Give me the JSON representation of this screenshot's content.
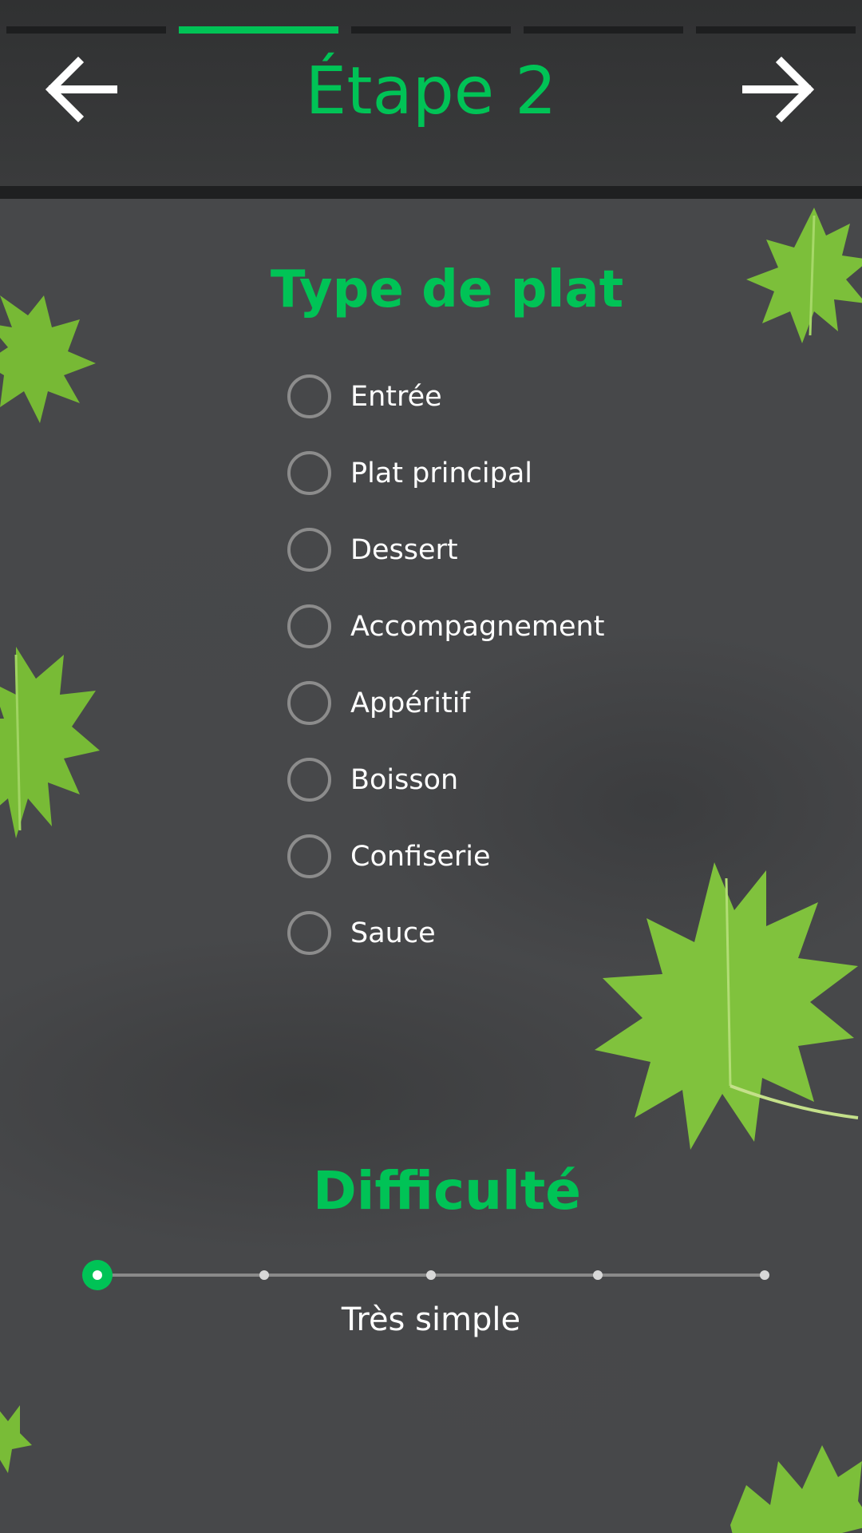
{
  "header": {
    "title": "Étape 2",
    "back_icon": "arrow-left-icon",
    "next_icon": "arrow-right-icon",
    "steps": [
      {
        "active": false
      },
      {
        "active": true
      },
      {
        "active": false
      },
      {
        "active": false
      },
      {
        "active": false
      }
    ]
  },
  "dish_type": {
    "title": "Type de plat",
    "options": [
      {
        "label": "Entrée",
        "selected": false
      },
      {
        "label": "Plat principal",
        "selected": false
      },
      {
        "label": "Dessert",
        "selected": false
      },
      {
        "label": "Accompagnement",
        "selected": false
      },
      {
        "label": "Appéritif",
        "selected": false
      },
      {
        "label": "Boisson",
        "selected": false
      },
      {
        "label": "Confiserie",
        "selected": false
      },
      {
        "label": "Sauce",
        "selected": false
      }
    ]
  },
  "difficulty": {
    "title": "Difficulté",
    "value_label": "Très simple",
    "level": 1,
    "levels": 5
  },
  "colors": {
    "accent": "#00c356",
    "header_bg": "#353637",
    "content_bg": "#47484a",
    "text": "#ffffff",
    "leaf": "#7cbf3a"
  }
}
